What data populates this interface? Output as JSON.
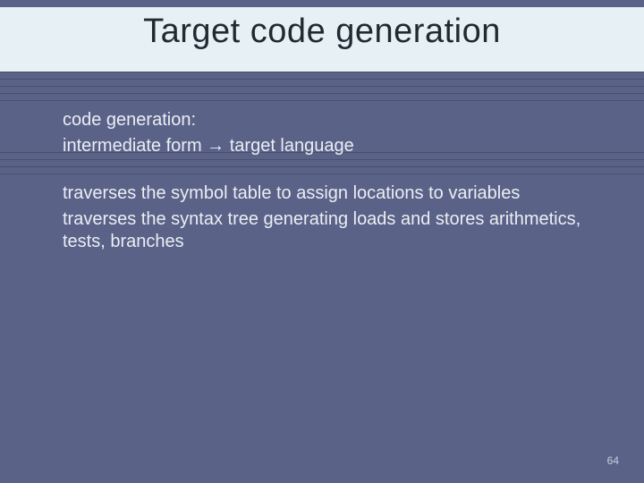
{
  "title": "Target code generation",
  "body": {
    "line1": "code generation:",
    "line2": "intermediate form → target language",
    "line3": "traverses the symbol table to assign locations to variables",
    "line4": "traverses the syntax tree generating loads and stores arithmetics, tests, branches"
  },
  "page_number": "64"
}
